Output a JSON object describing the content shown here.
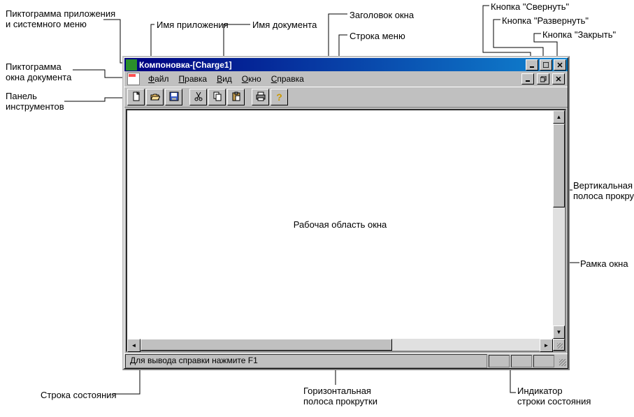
{
  "window": {
    "app_name": "Компоновка",
    "doc_name": "[Charge1]",
    "title_sep": " - "
  },
  "menu": {
    "file": "Файл",
    "edit": "Правка",
    "view": "Вид",
    "window": "Окно",
    "help": "Справка"
  },
  "workarea_text": "Рабочая область окна",
  "status_text": "Для вывода справки нажмите F1",
  "callouts": {
    "app_icon": "Пиктограмма приложения\nи системного меню",
    "app_name": "Имя приложения",
    "doc_name": "Имя документа",
    "title": "Заголовок окна",
    "menu_row": "Строка меню",
    "min_btn": "Кнопка \"Свернуть\"",
    "max_btn": "Кнопка \"Развернуть\"",
    "close_btn": "Кнопка \"Закрыть\"",
    "doc_icon": "Пиктограмма\nокна документа",
    "toolbar": "Панель\nинструментов",
    "vscroll": "Вертикальная\nполоса прокрутки",
    "frame": "Рамка окна",
    "hscroll": "Горизонтальная\nполоса прокрутки",
    "statusbar": "Строка состояния",
    "indicator": "Индикатор\nстроки состояния"
  }
}
